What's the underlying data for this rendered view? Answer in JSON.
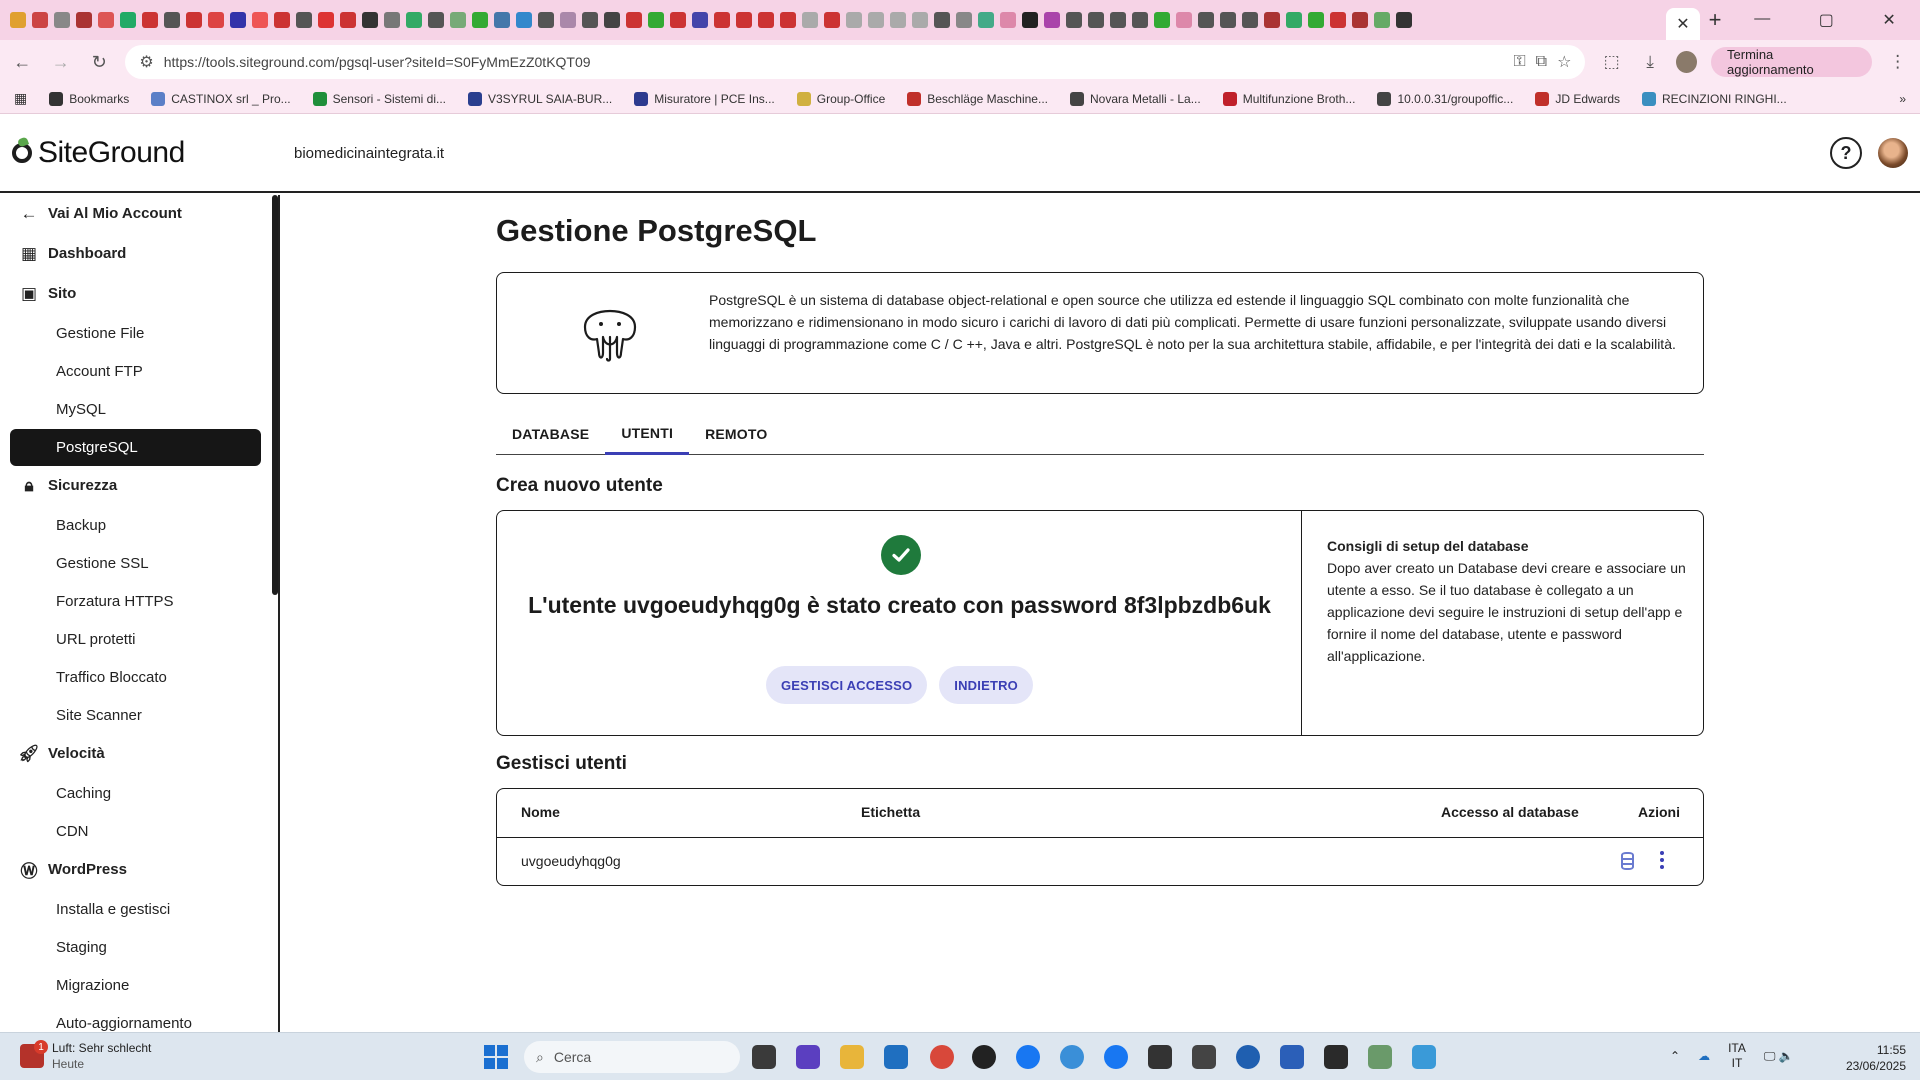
{
  "browser": {
    "url": "https://tools.siteground.com/pgsql-user?siteId=S0FyMmEzZ0tKQT09",
    "update_label": "Termina aggiornamento",
    "bookmarks": [
      {
        "label": "Bookmarks",
        "color": "#333333"
      },
      {
        "label": "CASTINOX srl _ Pro...",
        "color": "#5b7fc7"
      },
      {
        "label": "Sensori - Sistemi di...",
        "color": "#1f8f3a"
      },
      {
        "label": "V3SYRUL SAIA-BUR...",
        "color": "#2a3f8f"
      },
      {
        "label": "Misuratore | PCE Ins...",
        "color": "#2d3a8f"
      },
      {
        "label": "Group-Office",
        "color": "#d0b040"
      },
      {
        "label": "Beschläge Maschine...",
        "color": "#c0302a"
      },
      {
        "label": "Novara Metalli - La...",
        "color": "#444444"
      },
      {
        "label": "Multifunzione Broth...",
        "color": "#c0202a"
      },
      {
        "label": "10.0.0.31/groupoffic...",
        "color": "#444444"
      },
      {
        "label": "JD Edwards",
        "color": "#c0302a"
      },
      {
        "label": "RECINZIONI RINGHI...",
        "color": "#3a8fc0"
      }
    ]
  },
  "header": {
    "logo": "SiteGround",
    "domain": "biomedicinaintegrata.it"
  },
  "sidebar": {
    "back": "Vai Al Mio Account",
    "items": [
      {
        "label": "Dashboard",
        "type": "main",
        "icon": "grid-icon"
      },
      {
        "label": "Sito",
        "type": "main",
        "icon": "site-icon"
      },
      {
        "label": "Gestione File",
        "type": "sub"
      },
      {
        "label": "Account FTP",
        "type": "sub"
      },
      {
        "label": "MySQL",
        "type": "sub"
      },
      {
        "label": "PostgreSQL",
        "type": "sub",
        "active": true
      },
      {
        "label": "Sicurezza",
        "type": "main",
        "icon": "lock-icon"
      },
      {
        "label": "Backup",
        "type": "sub"
      },
      {
        "label": "Gestione SSL",
        "type": "sub"
      },
      {
        "label": "Forzatura HTTPS",
        "type": "sub"
      },
      {
        "label": "URL protetti",
        "type": "sub"
      },
      {
        "label": "Traffico Bloccato",
        "type": "sub"
      },
      {
        "label": "Site Scanner",
        "type": "sub"
      },
      {
        "label": "Velocità",
        "type": "main",
        "icon": "rocket-icon"
      },
      {
        "label": "Caching",
        "type": "sub"
      },
      {
        "label": "CDN",
        "type": "sub"
      },
      {
        "label": "WordPress",
        "type": "main",
        "icon": "wordpress-icon"
      },
      {
        "label": "Installa e gestisci",
        "type": "sub"
      },
      {
        "label": "Staging",
        "type": "sub"
      },
      {
        "label": "Migrazione",
        "type": "sub"
      },
      {
        "label": "Auto-aggiornamento",
        "type": "sub"
      }
    ]
  },
  "main": {
    "title": "Gestione PostgreSQL",
    "info": "PostgreSQL è un sistema di database object-relational e open source che utilizza ed estende il linguaggio SQL combinato con molte funzionalità che memorizzano e ridimensionano in modo sicuro i carichi di lavoro di dati più complicati. Permette di usare funzioni personalizzate, sviluppate usando diversi linguaggi di programmazione come C / C ++, Java e altri. PostgreSQL è noto per la sua architettura stabile, affidabile, e per l'integrità dei dati e la scalabilità.",
    "tabs": [
      {
        "label": "DATABASE",
        "active": false
      },
      {
        "label": "UTENTI",
        "active": true
      },
      {
        "label": "REMOTO",
        "active": false
      }
    ],
    "create_title": "Crea nuovo utente",
    "success_message": "L'utente uvgoeudyhqg0g è stato creato con password 8f3lpbzdb6uk",
    "manage_access_label": "GESTISCI ACCESSO",
    "back_label": "INDIETRO",
    "tips_title": "Consigli di setup del database",
    "tips_body": "Dopo aver creato un Database devi creare e associare un utente a esso. Se il tuo database è collegato a un applicazione devi seguire le instruzioni di setup dell'app e fornire il nome del database, utente e password all'applicazione.",
    "manage_title": "Gestisci utenti",
    "table": {
      "headers": [
        "Nome",
        "Etichetta",
        "Accesso al database",
        "Azioni"
      ],
      "rows": [
        {
          "name": "uvgoeudyhqg0g",
          "label": ""
        }
      ]
    }
  },
  "taskbar": {
    "weather_title": "Luft: Sehr schlecht",
    "weather_sub": "Heute",
    "weather_badge": "1",
    "search_placeholder": "Cerca",
    "lang_1": "ITA",
    "lang_2": "IT",
    "time": "11:55",
    "date": "23/06/2025"
  },
  "colors": {
    "accent": "#3b3fb5",
    "accent_bg": "#e4e5f8",
    "success": "#1f7a3c",
    "sidebar_active": "#161616"
  }
}
